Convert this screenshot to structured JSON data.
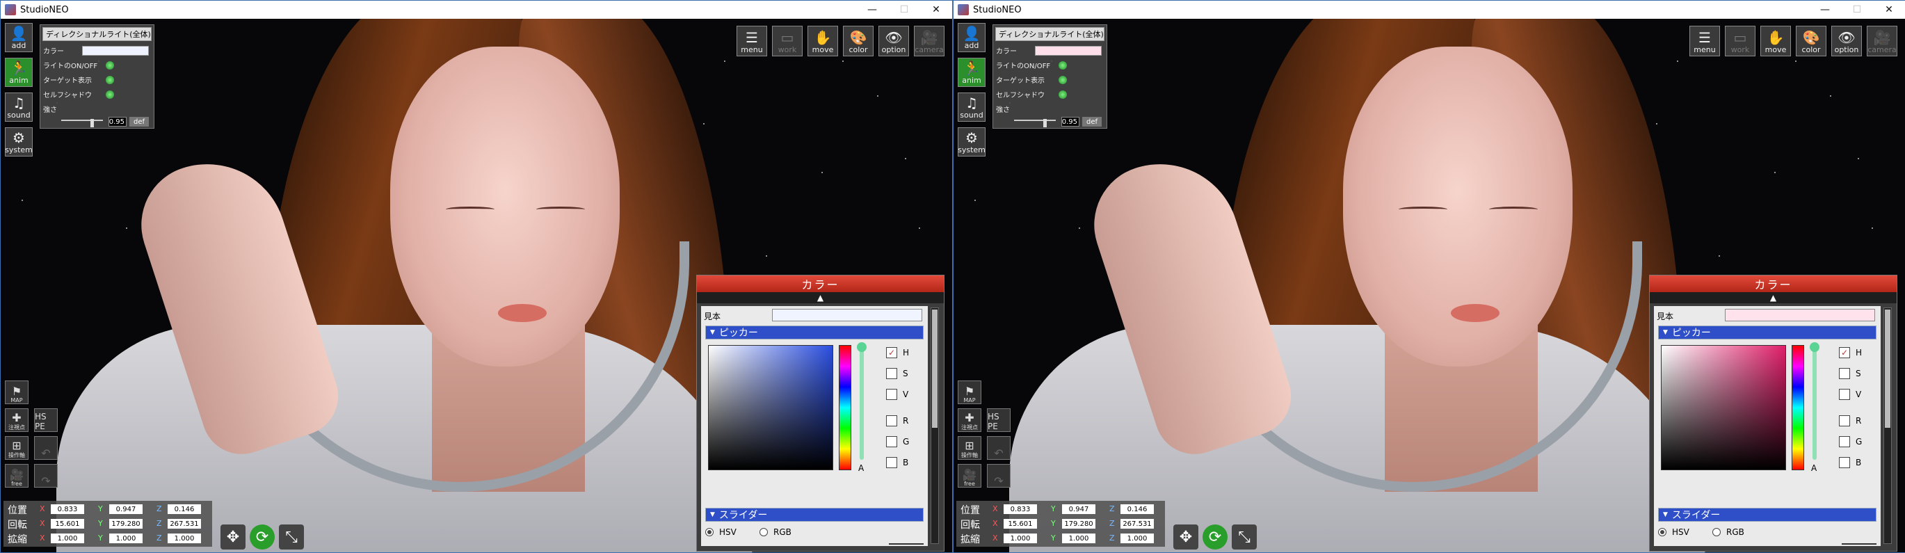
{
  "windows": [
    {
      "title": "StudioNEO",
      "left_tools": [
        "add",
        "anim",
        "sound",
        "system"
      ],
      "light_panel": {
        "header": "ディレクショナルライト(全体)",
        "color_label": "カラー",
        "rows": [
          "ライトのON/OFF",
          "ターゲット表示",
          "セルフシャドウ"
        ],
        "strength_label": "強さ",
        "strength_value": "0.95",
        "def_label": "def",
        "color": "#eef2ff"
      },
      "right_tools": [
        "menu",
        "work",
        "move",
        "color",
        "option",
        "camera"
      ],
      "small_icons": {
        "map": "MAP",
        "pivot": "注視点",
        "hspe": "HS PE",
        "op": "操作軸",
        "cam": "free"
      },
      "transform": {
        "rows": [
          {
            "label": "位置",
            "x": "0.833",
            "y": "0.947",
            "z": "0.146"
          },
          {
            "label": "回転",
            "x": "15.601",
            "y": "179.280",
            "z": "267.531"
          },
          {
            "label": "拡縮",
            "x": "1.000",
            "y": "1.000",
            "z": "1.000"
          }
        ],
        "axes": [
          "X",
          "Y",
          "Z"
        ]
      },
      "color_panel": {
        "title": "カラー",
        "sample_label": "見本",
        "sample_color": "#f0f4ff",
        "picker_label": "ピッカー",
        "slider_label": "スライダー",
        "options": [
          "H",
          "S",
          "V",
          "R",
          "G",
          "B"
        ],
        "alpha": "A",
        "hsv": "HSV",
        "rgb": "RGB",
        "hue_color": "#2a4ee0"
      }
    },
    {
      "title": "StudioNEO",
      "left_tools": [
        "add",
        "anim",
        "sound",
        "system"
      ],
      "light_panel": {
        "header": "ディレクショナルライト(全体)",
        "color_label": "カラー",
        "rows": [
          "ライトのON/OFF",
          "ターゲット表示",
          "セルフシャドウ"
        ],
        "strength_label": "強さ",
        "strength_value": "0.95",
        "def_label": "def",
        "color": "#ffe0ea"
      },
      "right_tools": [
        "menu",
        "work",
        "move",
        "color",
        "option",
        "camera"
      ],
      "small_icons": {
        "map": "MAP",
        "pivot": "注視点",
        "hspe": "HS PE",
        "op": "操作軸",
        "cam": "free"
      },
      "transform": {
        "rows": [
          {
            "label": "位置",
            "x": "0.833",
            "y": "0.947",
            "z": "0.146"
          },
          {
            "label": "回転",
            "x": "15.601",
            "y": "179.280",
            "z": "267.531"
          },
          {
            "label": "拡縮",
            "x": "1.000",
            "y": "1.000",
            "z": "1.000"
          }
        ],
        "axes": [
          "X",
          "Y",
          "Z"
        ]
      },
      "color_panel": {
        "title": "カラー",
        "sample_label": "見本",
        "sample_color": "#ffe2ec",
        "picker_label": "ピッカー",
        "slider_label": "スライダー",
        "options": [
          "H",
          "S",
          "V",
          "R",
          "G",
          "B"
        ],
        "alpha": "A",
        "hsv": "HSV",
        "rgb": "RGB",
        "hue_color": "#e01f6a"
      }
    }
  ],
  "titlebar_buttons": {
    "minimize": "—",
    "maximize": "☐",
    "close": "✕"
  }
}
